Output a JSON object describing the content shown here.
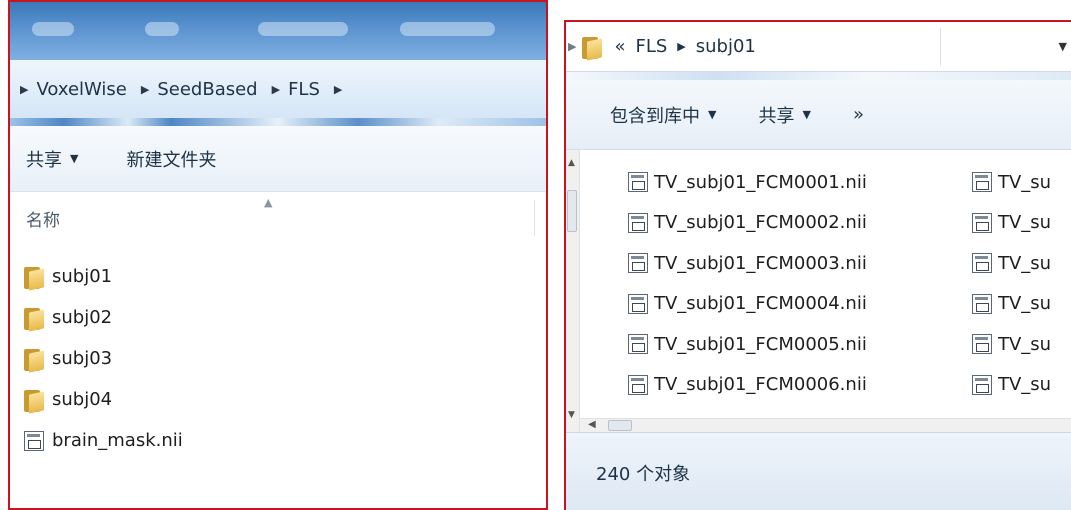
{
  "left_window": {
    "breadcrumb": [
      "VoxelWise",
      "SeedBased",
      "FLS"
    ],
    "toolbar": {
      "share_label": "共享",
      "new_folder_label": "新建文件夹"
    },
    "column_header": {
      "name_label": "名称"
    },
    "items": [
      {
        "name": "subj01",
        "icon": "folder-icon"
      },
      {
        "name": "subj02",
        "icon": "folder-icon"
      },
      {
        "name": "subj03",
        "icon": "folder-icon"
      },
      {
        "name": "subj04",
        "icon": "folder-icon"
      },
      {
        "name": "brain_mask.nii",
        "icon": "nii-file-icon"
      }
    ]
  },
  "right_window": {
    "address": {
      "overflow_label": "«",
      "path": [
        "FLS",
        "subj01"
      ]
    },
    "toolbar": {
      "include_in_library_label": "包含到库中",
      "share_label": "共享",
      "more_label": "»"
    },
    "files_col1": [
      "TV_subj01_FCM0001.nii",
      "TV_subj01_FCM0002.nii",
      "TV_subj01_FCM0003.nii",
      "TV_subj01_FCM0004.nii",
      "TV_subj01_FCM0005.nii",
      "TV_subj01_FCM0006.nii"
    ],
    "files_col2": [
      "TV_su",
      "TV_su",
      "TV_su",
      "TV_su",
      "TV_su",
      "TV_su"
    ],
    "status": {
      "object_count": "240 个对象"
    }
  },
  "colors": {
    "panel_border": "#c8141e",
    "titlebar": "#5b93cf",
    "addressbar": "#d5e6f7"
  }
}
